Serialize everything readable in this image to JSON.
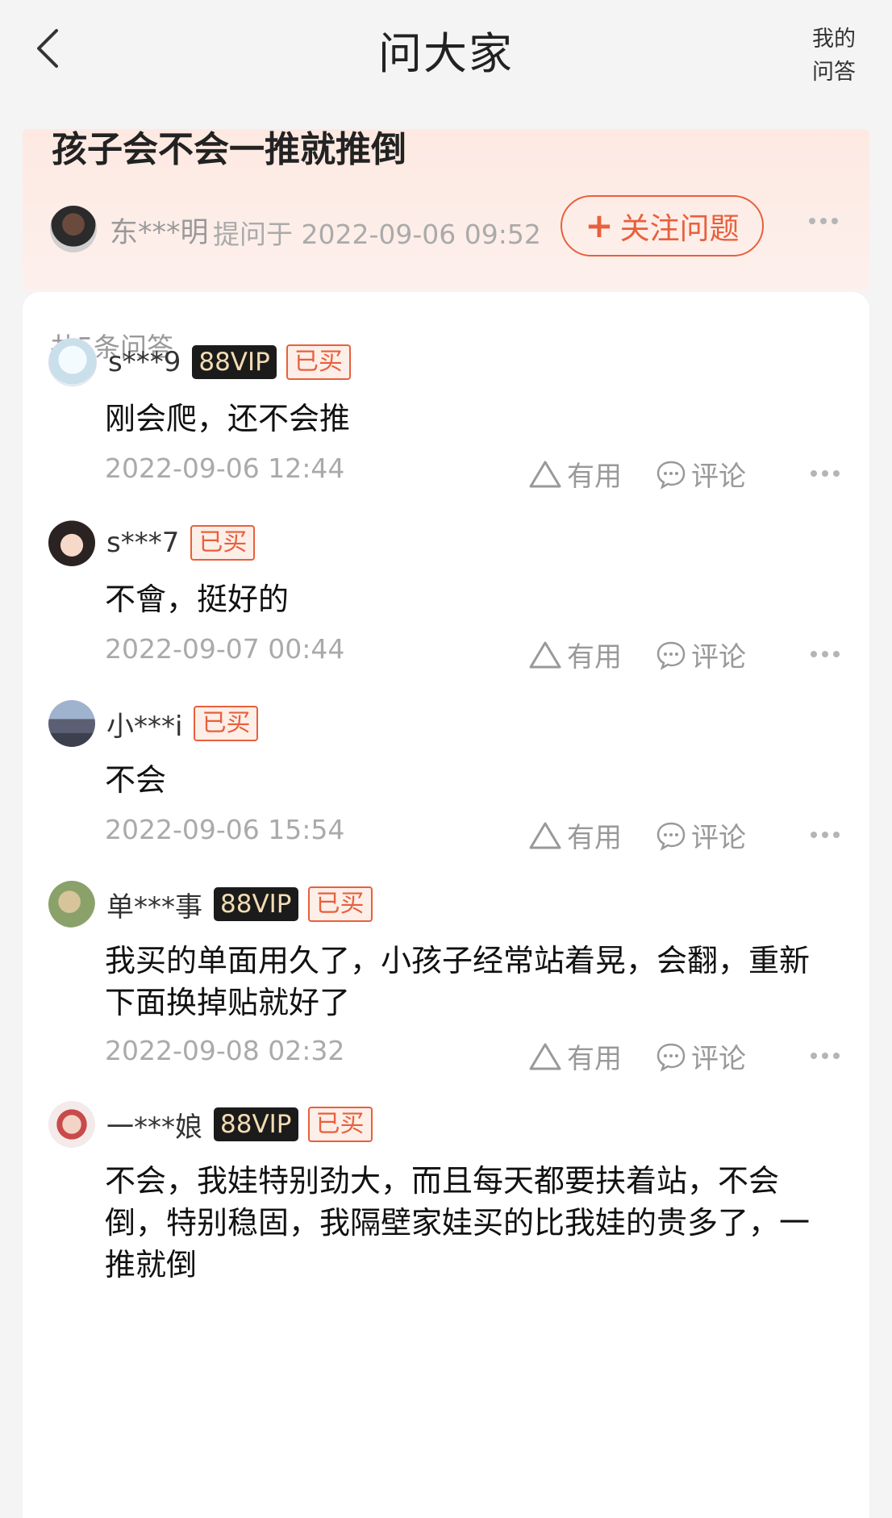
{
  "header": {
    "title": "问大家",
    "my_qa_line1": "我的",
    "my_qa_line2": "问答"
  },
  "question": {
    "title": "孩子会不会一推就推倒",
    "asker": "东***明",
    "asked_meta": "提问于 2022-09-06 09:52",
    "follow_label": "关注问题"
  },
  "answers_total": "共5条问答",
  "actions": {
    "useful": "有用",
    "comment": "评论"
  },
  "answers": [
    {
      "user": "s***9",
      "vip": "88VIP",
      "badge": "已买",
      "text": "刚会爬，还不会推",
      "date": "2022-09-06 12:44"
    },
    {
      "user": "s***7",
      "badge": "已买",
      "text": "不會，挺好的",
      "date": "2022-09-07 00:44"
    },
    {
      "user": "小***i",
      "badge": "已买",
      "text": "不会",
      "date": "2022-09-06 15:54"
    },
    {
      "user": "单***事",
      "vip": "88VIP",
      "badge": "已买",
      "text": "我买的单面用久了，小孩子经常站着晃，会翻，重新下面换掉贴就好了",
      "date": "2022-09-08 02:32"
    },
    {
      "user": "一***娘",
      "vip": "88VIP",
      "badge": "已买",
      "text": "不会，我娃特别劲大，而且每天都要扶着站，不会倒，特别稳固，我隔壁家娃买的比我娃的贵多了，一推就倒"
    }
  ]
}
